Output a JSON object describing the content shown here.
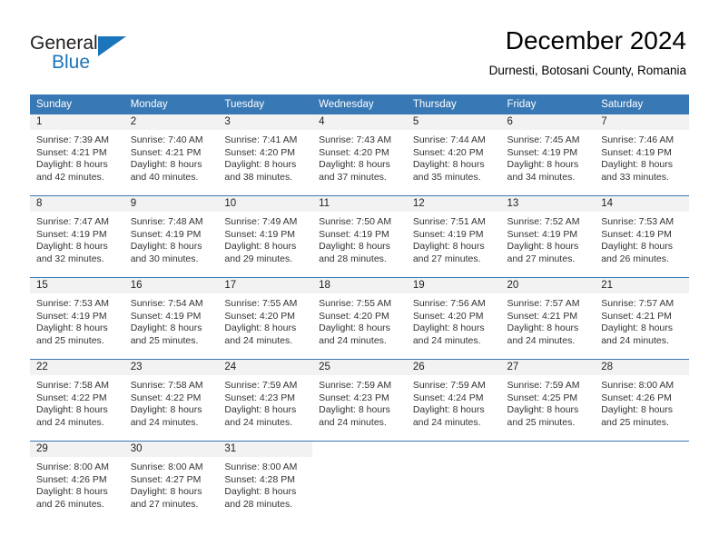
{
  "brand": {
    "name_part1": "General",
    "name_part2": "Blue",
    "accent_color": "#1b75bb"
  },
  "header": {
    "title": "December 2024",
    "subtitle": "Durnesti, Botosani County, Romania"
  },
  "theme": {
    "header_row_color": "#3878b4",
    "daynum_band_color": "#f2f2f2",
    "grid_line_color": "#3878b4"
  },
  "weekdays": [
    "Sunday",
    "Monday",
    "Tuesday",
    "Wednesday",
    "Thursday",
    "Friday",
    "Saturday"
  ],
  "weeks": [
    [
      {
        "day": "1",
        "sunrise": "Sunrise: 7:39 AM",
        "sunset": "Sunset: 4:21 PM",
        "daylight1": "Daylight: 8 hours",
        "daylight2": "and 42 minutes."
      },
      {
        "day": "2",
        "sunrise": "Sunrise: 7:40 AM",
        "sunset": "Sunset: 4:21 PM",
        "daylight1": "Daylight: 8 hours",
        "daylight2": "and 40 minutes."
      },
      {
        "day": "3",
        "sunrise": "Sunrise: 7:41 AM",
        "sunset": "Sunset: 4:20 PM",
        "daylight1": "Daylight: 8 hours",
        "daylight2": "and 38 minutes."
      },
      {
        "day": "4",
        "sunrise": "Sunrise: 7:43 AM",
        "sunset": "Sunset: 4:20 PM",
        "daylight1": "Daylight: 8 hours",
        "daylight2": "and 37 minutes."
      },
      {
        "day": "5",
        "sunrise": "Sunrise: 7:44 AM",
        "sunset": "Sunset: 4:20 PM",
        "daylight1": "Daylight: 8 hours",
        "daylight2": "and 35 minutes."
      },
      {
        "day": "6",
        "sunrise": "Sunrise: 7:45 AM",
        "sunset": "Sunset: 4:19 PM",
        "daylight1": "Daylight: 8 hours",
        "daylight2": "and 34 minutes."
      },
      {
        "day": "7",
        "sunrise": "Sunrise: 7:46 AM",
        "sunset": "Sunset: 4:19 PM",
        "daylight1": "Daylight: 8 hours",
        "daylight2": "and 33 minutes."
      }
    ],
    [
      {
        "day": "8",
        "sunrise": "Sunrise: 7:47 AM",
        "sunset": "Sunset: 4:19 PM",
        "daylight1": "Daylight: 8 hours",
        "daylight2": "and 32 minutes."
      },
      {
        "day": "9",
        "sunrise": "Sunrise: 7:48 AM",
        "sunset": "Sunset: 4:19 PM",
        "daylight1": "Daylight: 8 hours",
        "daylight2": "and 30 minutes."
      },
      {
        "day": "10",
        "sunrise": "Sunrise: 7:49 AM",
        "sunset": "Sunset: 4:19 PM",
        "daylight1": "Daylight: 8 hours",
        "daylight2": "and 29 minutes."
      },
      {
        "day": "11",
        "sunrise": "Sunrise: 7:50 AM",
        "sunset": "Sunset: 4:19 PM",
        "daylight1": "Daylight: 8 hours",
        "daylight2": "and 28 minutes."
      },
      {
        "day": "12",
        "sunrise": "Sunrise: 7:51 AM",
        "sunset": "Sunset: 4:19 PM",
        "daylight1": "Daylight: 8 hours",
        "daylight2": "and 27 minutes."
      },
      {
        "day": "13",
        "sunrise": "Sunrise: 7:52 AM",
        "sunset": "Sunset: 4:19 PM",
        "daylight1": "Daylight: 8 hours",
        "daylight2": "and 27 minutes."
      },
      {
        "day": "14",
        "sunrise": "Sunrise: 7:53 AM",
        "sunset": "Sunset: 4:19 PM",
        "daylight1": "Daylight: 8 hours",
        "daylight2": "and 26 minutes."
      }
    ],
    [
      {
        "day": "15",
        "sunrise": "Sunrise: 7:53 AM",
        "sunset": "Sunset: 4:19 PM",
        "daylight1": "Daylight: 8 hours",
        "daylight2": "and 25 minutes."
      },
      {
        "day": "16",
        "sunrise": "Sunrise: 7:54 AM",
        "sunset": "Sunset: 4:19 PM",
        "daylight1": "Daylight: 8 hours",
        "daylight2": "and 25 minutes."
      },
      {
        "day": "17",
        "sunrise": "Sunrise: 7:55 AM",
        "sunset": "Sunset: 4:20 PM",
        "daylight1": "Daylight: 8 hours",
        "daylight2": "and 24 minutes."
      },
      {
        "day": "18",
        "sunrise": "Sunrise: 7:55 AM",
        "sunset": "Sunset: 4:20 PM",
        "daylight1": "Daylight: 8 hours",
        "daylight2": "and 24 minutes."
      },
      {
        "day": "19",
        "sunrise": "Sunrise: 7:56 AM",
        "sunset": "Sunset: 4:20 PM",
        "daylight1": "Daylight: 8 hours",
        "daylight2": "and 24 minutes."
      },
      {
        "day": "20",
        "sunrise": "Sunrise: 7:57 AM",
        "sunset": "Sunset: 4:21 PM",
        "daylight1": "Daylight: 8 hours",
        "daylight2": "and 24 minutes."
      },
      {
        "day": "21",
        "sunrise": "Sunrise: 7:57 AM",
        "sunset": "Sunset: 4:21 PM",
        "daylight1": "Daylight: 8 hours",
        "daylight2": "and 24 minutes."
      }
    ],
    [
      {
        "day": "22",
        "sunrise": "Sunrise: 7:58 AM",
        "sunset": "Sunset: 4:22 PM",
        "daylight1": "Daylight: 8 hours",
        "daylight2": "and 24 minutes."
      },
      {
        "day": "23",
        "sunrise": "Sunrise: 7:58 AM",
        "sunset": "Sunset: 4:22 PM",
        "daylight1": "Daylight: 8 hours",
        "daylight2": "and 24 minutes."
      },
      {
        "day": "24",
        "sunrise": "Sunrise: 7:59 AM",
        "sunset": "Sunset: 4:23 PM",
        "daylight1": "Daylight: 8 hours",
        "daylight2": "and 24 minutes."
      },
      {
        "day": "25",
        "sunrise": "Sunrise: 7:59 AM",
        "sunset": "Sunset: 4:23 PM",
        "daylight1": "Daylight: 8 hours",
        "daylight2": "and 24 minutes."
      },
      {
        "day": "26",
        "sunrise": "Sunrise: 7:59 AM",
        "sunset": "Sunset: 4:24 PM",
        "daylight1": "Daylight: 8 hours",
        "daylight2": "and 24 minutes."
      },
      {
        "day": "27",
        "sunrise": "Sunrise: 7:59 AM",
        "sunset": "Sunset: 4:25 PM",
        "daylight1": "Daylight: 8 hours",
        "daylight2": "and 25 minutes."
      },
      {
        "day": "28",
        "sunrise": "Sunrise: 8:00 AM",
        "sunset": "Sunset: 4:26 PM",
        "daylight1": "Daylight: 8 hours",
        "daylight2": "and 25 minutes."
      }
    ],
    [
      {
        "day": "29",
        "sunrise": "Sunrise: 8:00 AM",
        "sunset": "Sunset: 4:26 PM",
        "daylight1": "Daylight: 8 hours",
        "daylight2": "and 26 minutes."
      },
      {
        "day": "30",
        "sunrise": "Sunrise: 8:00 AM",
        "sunset": "Sunset: 4:27 PM",
        "daylight1": "Daylight: 8 hours",
        "daylight2": "and 27 minutes."
      },
      {
        "day": "31",
        "sunrise": "Sunrise: 8:00 AM",
        "sunset": "Sunset: 4:28 PM",
        "daylight1": "Daylight: 8 hours",
        "daylight2": "and 28 minutes."
      },
      {
        "day": "",
        "sunrise": "",
        "sunset": "",
        "daylight1": "",
        "daylight2": ""
      },
      {
        "day": "",
        "sunrise": "",
        "sunset": "",
        "daylight1": "",
        "daylight2": ""
      },
      {
        "day": "",
        "sunrise": "",
        "sunset": "",
        "daylight1": "",
        "daylight2": ""
      },
      {
        "day": "",
        "sunrise": "",
        "sunset": "",
        "daylight1": "",
        "daylight2": ""
      }
    ]
  ]
}
